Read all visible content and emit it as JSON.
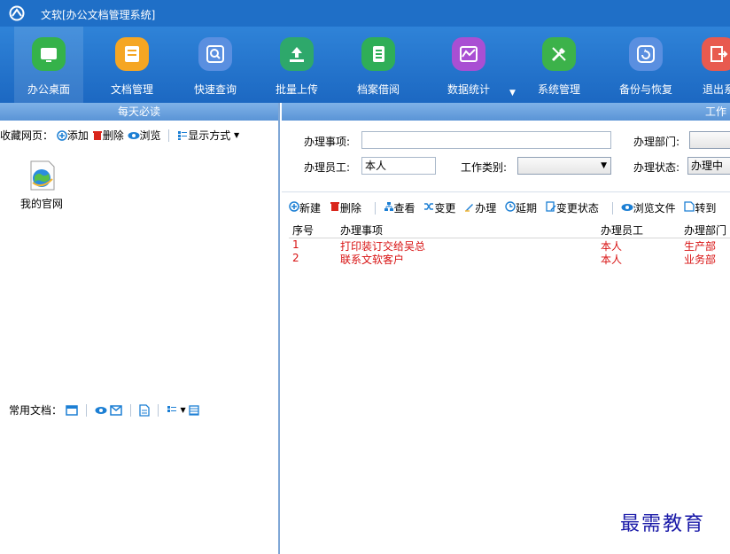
{
  "app": {
    "title": "文软[办公文档管理系统]"
  },
  "toolbar": {
    "items": [
      {
        "label": "办公桌面",
        "icon": "desktop-icon",
        "color": "#35b24a"
      },
      {
        "label": "文档管理",
        "icon": "document-manage-icon",
        "color": "#f5a623"
      },
      {
        "label": "快速查询",
        "icon": "quick-search-icon",
        "color": "#5a8fe0"
      },
      {
        "label": "批量上传",
        "icon": "upload-icon",
        "color": "#2ea86b"
      },
      {
        "label": "档案借阅",
        "icon": "archive-borrow-icon",
        "color": "#2fae57"
      },
      {
        "label": "数据统计",
        "icon": "statistics-icon",
        "color": "#a94fd3"
      },
      {
        "label": "系统管理",
        "icon": "system-manage-icon",
        "color": "#3cb24a"
      },
      {
        "label": "备份与恢复",
        "icon": "backup-restore-icon",
        "color": "#5a8fe0"
      },
      {
        "label": "退出系",
        "icon": "exit-icon",
        "color": "#e85a4f"
      }
    ]
  },
  "left_panel": {
    "header": "每天必读",
    "favorites_label": "收藏网页：",
    "add": "添加",
    "delete": "删除",
    "browse": "浏览",
    "display_mode": "显示方式",
    "shortcut_name": "我的官网",
    "docs_label": "常用文档："
  },
  "right_panel": {
    "header": "工作",
    "form": {
      "item_label": "办理事项:",
      "item_value": "",
      "dept_label": "办理部门:",
      "staff_label": "办理员工:",
      "staff_value": "本人",
      "type_label": "工作类别:",
      "type_value": "",
      "status_label": "办理状态:",
      "status_value": "办理中"
    },
    "actions": {
      "new": "新建",
      "delete": "删除",
      "view": "查看",
      "change": "变更",
      "handle": "办理",
      "extend": "延期",
      "change_status": "变更状态",
      "browse_file": "浏览文件",
      "transfer": "转到"
    },
    "table": {
      "columns": [
        "序号",
        "办理事项",
        "办理员工",
        "办理部门"
      ],
      "rows": [
        [
          "1",
          "打印装订交给吴总",
          "本人",
          "生产部"
        ],
        [
          "2",
          "联系文软客户",
          "本人",
          "业务部"
        ]
      ]
    }
  },
  "watermark": "最需教育"
}
